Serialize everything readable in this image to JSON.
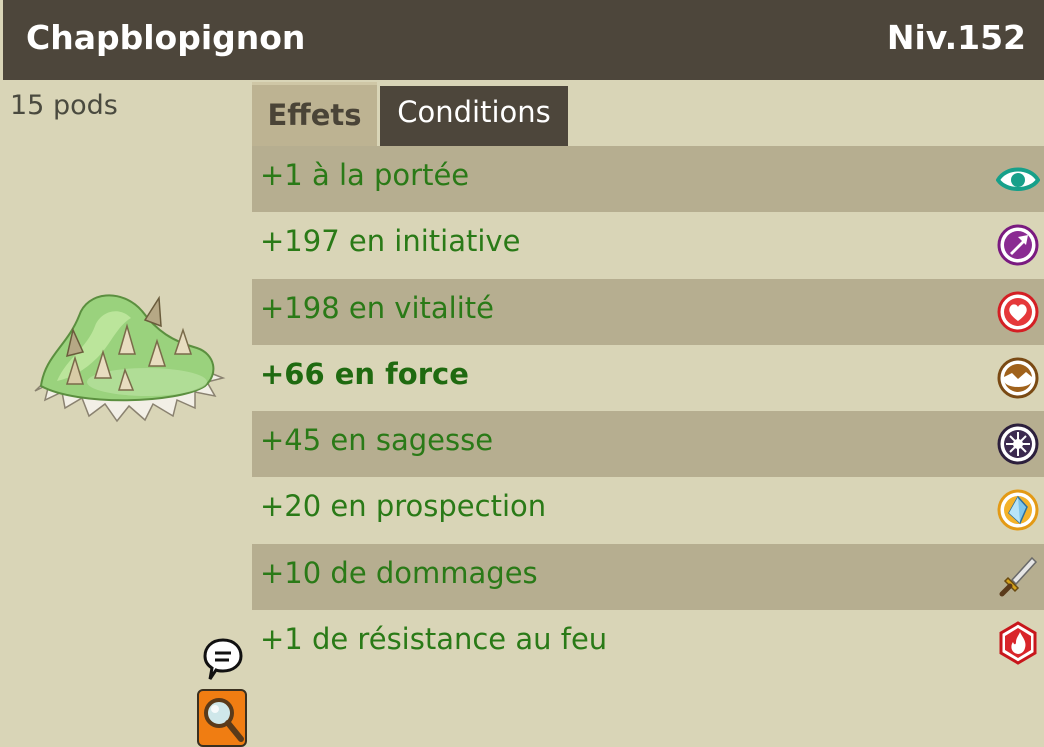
{
  "header": {
    "item_name": "Chapblopignon",
    "level": "Niv.152"
  },
  "left": {
    "weight": "15 pods",
    "item_image_icon": "spiky-green-mushroom-hat",
    "chat_icon": "speech-bubble-icon",
    "inspect_icon": "magnifier-icon"
  },
  "tabs": [
    {
      "label": "Effets",
      "active": true
    },
    {
      "label": "Conditions",
      "active": false
    }
  ],
  "effects": [
    {
      "text": "+1 à la portée",
      "icon": "eye-icon",
      "bold": false
    },
    {
      "text": "+197 en initiative",
      "icon": "arrow-icon",
      "bold": false
    },
    {
      "text": "+198 en vitalité",
      "icon": "heart-icon",
      "bold": false
    },
    {
      "text": "+66 en force",
      "icon": "earth-icon",
      "bold": true
    },
    {
      "text": "+45 en sagesse",
      "icon": "wisdom-icon",
      "bold": false
    },
    {
      "text": "+20 en prospection",
      "icon": "crystal-icon",
      "bold": false
    },
    {
      "text": "+10 de dommages",
      "icon": "sword-icon",
      "bold": false
    },
    {
      "text": "+1 de résistance au feu",
      "icon": "fire-icon",
      "bold": false
    }
  ],
  "colors": {
    "header_bg": "#4d463b",
    "panel_bg": "#d9d5b7",
    "row_dark": "#b6ae90",
    "effect_text": "#2a7a17"
  }
}
